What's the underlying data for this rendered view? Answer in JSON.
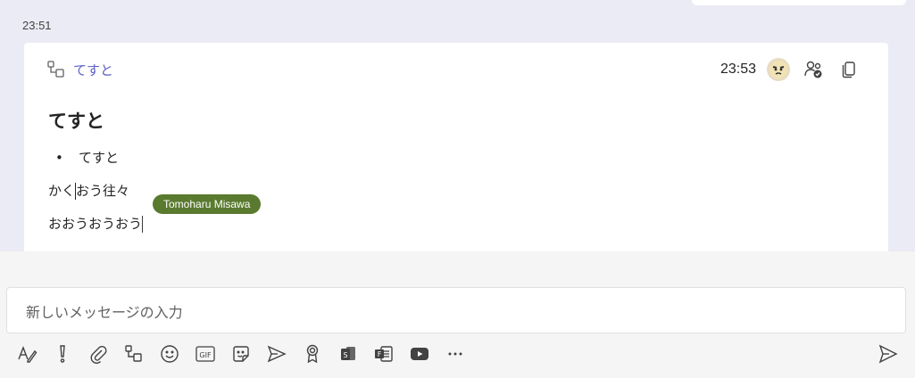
{
  "chat": {
    "timestamp": "23:51",
    "card": {
      "loop_title": "てすと",
      "edited_time": "23:53",
      "content": {
        "heading": "てすと",
        "bullet": "てすと",
        "line1_before": "かく",
        "line1_after": "おう往々",
        "line2": "おおうおうおう"
      },
      "presence_name": "Tomoharu Misawa"
    }
  },
  "compose": {
    "placeholder": "新しいメッセージの入力"
  },
  "toolbar": {
    "items": [
      "format-icon",
      "important-icon",
      "attach-icon",
      "loop-icon",
      "emoji-icon",
      "gif-icon",
      "sticker-icon",
      "schedule-meeting-icon",
      "praise-icon",
      "stream-icon",
      "forms-icon",
      "youtube-icon",
      "more-icon"
    ],
    "gif_label": "GIF",
    "more_label": "···"
  },
  "colors": {
    "accent": "#5b5fc7",
    "presence": "#5a7a2f",
    "chat_bg": "#ebebf5"
  }
}
